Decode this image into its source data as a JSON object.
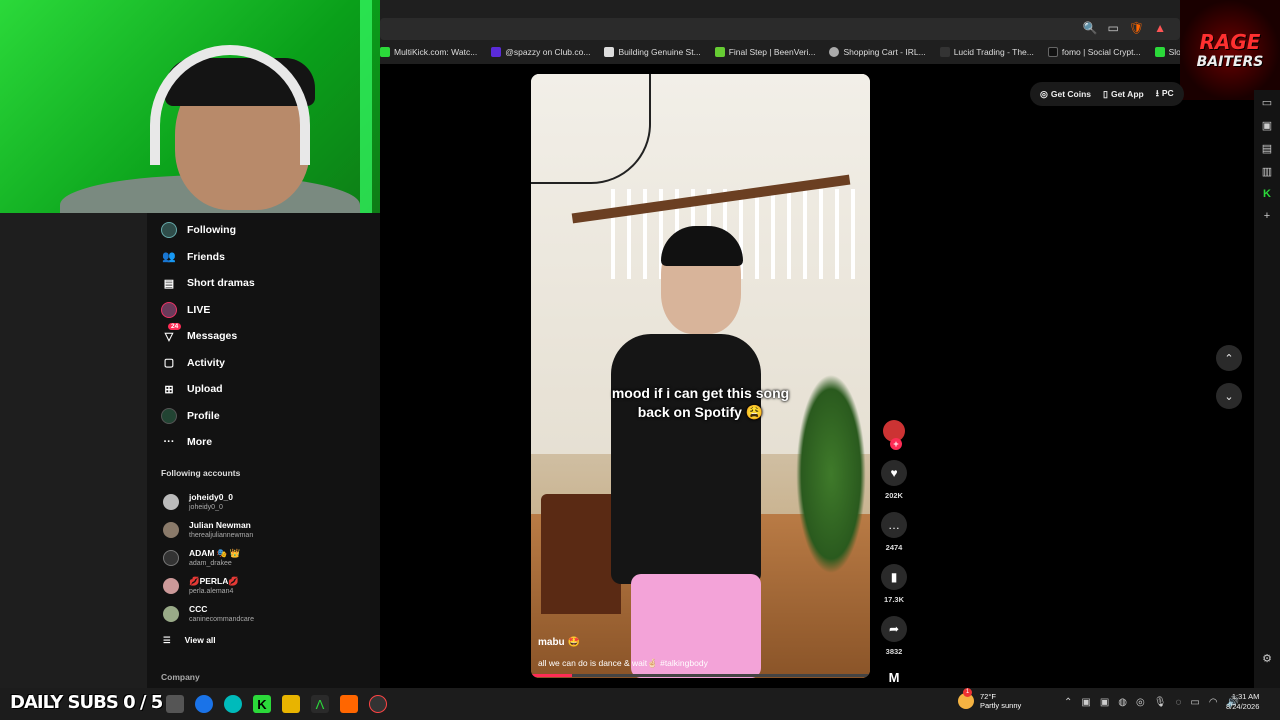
{
  "browser": {
    "bookmarks": [
      {
        "icon": "kick-icon",
        "label": "MultiKick.com: Watc..."
      },
      {
        "icon": "club-icon",
        "label": "@spazzy on Club.co..."
      },
      {
        "icon": "doc-icon",
        "label": "Building Genuine St..."
      },
      {
        "icon": "beenverified-icon",
        "label": "Final Step | BeenVeri..."
      },
      {
        "icon": "cart-icon",
        "label": "Shopping Cart - IRL..."
      },
      {
        "icon": "lucid-icon",
        "label": "Lucid Trading - The..."
      },
      {
        "icon": "fomo-icon",
        "label": "fomo | Social Crypt..."
      },
      {
        "icon": "slope-icon",
        "label": "Slope Game"
      }
    ]
  },
  "overlay": {
    "logo_line1": "RAGE",
    "logo_line2": "BAITERS",
    "subs_counter": "DAILY SUBS 0 / 5"
  },
  "sidebar": {
    "nav": [
      {
        "icon": "following-avatar-icon",
        "label": "Following"
      },
      {
        "icon": "friends-icon",
        "label": "Friends"
      },
      {
        "icon": "short-dramas-icon",
        "label": "Short dramas"
      },
      {
        "icon": "live-icon",
        "label": "LIVE"
      },
      {
        "icon": "messages-icon",
        "label": "Messages",
        "badge": "24"
      },
      {
        "icon": "activity-icon",
        "label": "Activity"
      },
      {
        "icon": "upload-icon",
        "label": "Upload"
      },
      {
        "icon": "profile-icon",
        "label": "Profile"
      },
      {
        "icon": "more-icon",
        "label": "More"
      }
    ],
    "following_title": "Following accounts",
    "accounts": [
      {
        "name": "joheidy0_0",
        "handle": "joheidy0_0"
      },
      {
        "name": "Julian Newman",
        "handle": "therealjuliannewman"
      },
      {
        "name": "ADAM 🎭 👑",
        "handle": "adam_drakee"
      },
      {
        "name": "💋PERLA💋",
        "handle": "perla.aleman4"
      },
      {
        "name": "CCC",
        "handle": "caninecommandcare"
      }
    ],
    "view_all": "View all",
    "company": "Company"
  },
  "header": {
    "get_coins": "Get Coins",
    "get_app": "Get App",
    "pc": "PC"
  },
  "video": {
    "caption_line1": "mood if i can get this song",
    "caption_line2": "back on Spotify 😩",
    "author": "mabu 🤩",
    "description": "all we can do is dance & wait🤞🏻 #talkingbody",
    "progress": 0.12
  },
  "actions": {
    "likes": "202K",
    "comments": "2474",
    "saves": "17.3K",
    "shares": "3832"
  },
  "taskbar": {
    "weather_temp": "72°F",
    "weather_desc": "Partly sunny",
    "weather_badge": "1",
    "time": "1:31 AM",
    "date": "8/24/2026"
  },
  "colors": {
    "accent": "#fe2c55",
    "green_screen": "#2bd93a"
  }
}
